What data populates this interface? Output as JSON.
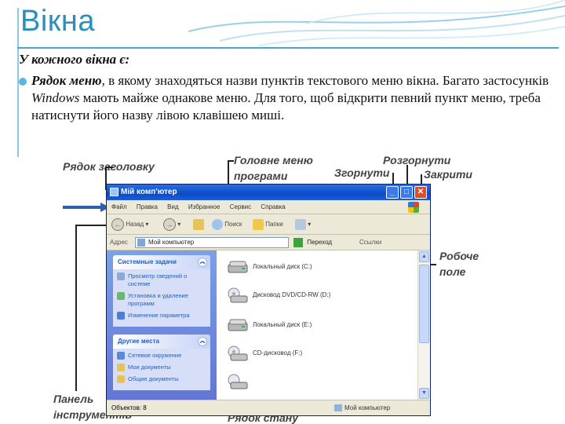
{
  "slide": {
    "title": "Вікна",
    "intro": "У кожного вікна є:",
    "bullet": {
      "term": "Рядок меню",
      "part1": ", в якому знаходяться назви пунктів текстового меню вікна. Багато застосунків ",
      "app": "Windows",
      "part2": " мають майже однакове меню. Для того, щоб відкрити певний пункт меню, треба натиснути його назву лівою клавішею миші."
    }
  },
  "callouts": {
    "title_bar": "Рядок заголовку",
    "main_menu_line1": "Головне меню",
    "main_menu_line2": "програми",
    "maximize": "Розгорнути",
    "minimize": "Згорнути",
    "close": "Закрити",
    "work_area_line1": "Робоче",
    "work_area_line2": "поле",
    "toolbar_line1": "Панель",
    "toolbar_line2": "інструментів",
    "status_bar": "Рядок стану"
  },
  "window": {
    "title": "Мій комп'ютер",
    "menu": [
      "Файл",
      "Правка",
      "Вид",
      "Избранное",
      "Сервис",
      "Справка"
    ],
    "toolbar": {
      "back": "Назад",
      "search": "Поиск",
      "folders": "Папки"
    },
    "address": {
      "label": "Адрес",
      "value": "Мой компьютер",
      "go": "Переход",
      "links": "Ссылки"
    },
    "left_panels": [
      {
        "title": "Системные задачи",
        "items": [
          "Просмотр сведений о системе",
          "Установка и удаление программ",
          "Изменение параметра"
        ]
      },
      {
        "title": "Другие места",
        "items": [
          "Сетевое окружение",
          "Мои документы",
          "Общие документы"
        ]
      }
    ],
    "drives": [
      "Локальный диск (C:)",
      "Дисковод DVD/CD-RW (D:)",
      "Локальный диск (E:)",
      "CD-дисковод (F:)"
    ],
    "status_left": "Объектов: 8",
    "status_right": "Мой компьютер"
  },
  "colors": {
    "title_blue": "#2a8fbf",
    "bullet_dot": "#5ab7dd",
    "xp_titlebar": "#0b4ac8",
    "xp_close": "#d8502c"
  }
}
